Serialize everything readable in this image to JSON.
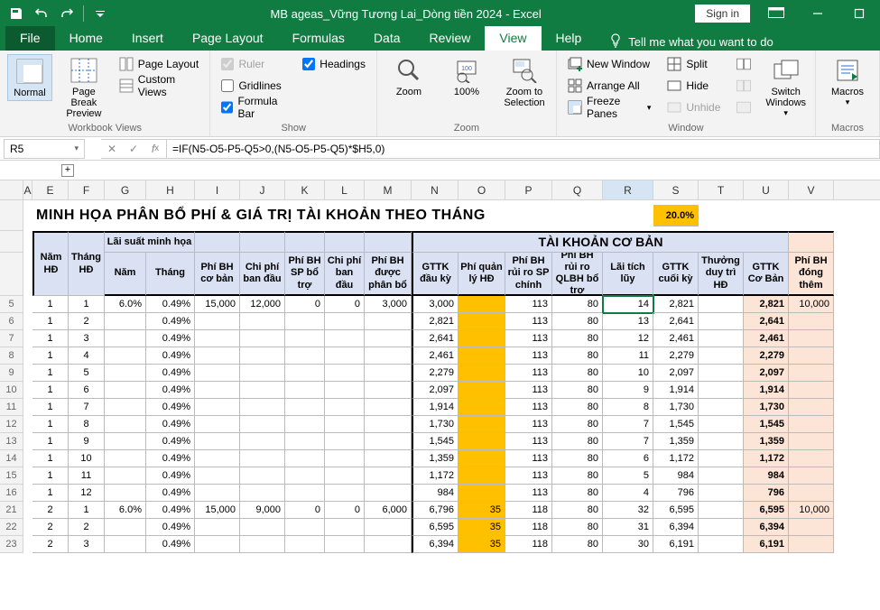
{
  "titlebar": {
    "title": "MB ageas_Vững Tương Lai_Dòng tiền 2024 - Excel",
    "signin": "Sign in"
  },
  "tabs": {
    "file": "File",
    "home": "Home",
    "insert": "Insert",
    "pagelayout": "Page Layout",
    "formulas": "Formulas",
    "data": "Data",
    "review": "Review",
    "view": "View",
    "help": "Help",
    "tellme": "Tell me what you want to do"
  },
  "ribbon": {
    "groups": {
      "views": "Workbook Views",
      "show": "Show",
      "zoom": "Zoom",
      "window": "Window",
      "macros": "Macros"
    },
    "buttons": {
      "normal": "Normal",
      "pagebreak": "Page Break Preview",
      "pagelayout": "Page Layout",
      "custom": "Custom Views",
      "ruler": "Ruler",
      "gridlines": "Gridlines",
      "formulabar": "Formula Bar",
      "headings": "Headings",
      "zoom": "Zoom",
      "z100": "100%",
      "zoomsel": "Zoom to Selection",
      "newwin": "New Window",
      "arrange": "Arrange All",
      "freeze": "Freeze Panes",
      "split": "Split",
      "hide": "Hide",
      "unhide": "Unhide",
      "switch": "Switch Windows",
      "macros": "Macros"
    }
  },
  "formulabar": {
    "cellref": "R5",
    "formula": "=IF(N5-O5-P5-Q5>0,(N5-O5-P5-Q5)*$H5,0)"
  },
  "columns": [
    "A",
    "E",
    "F",
    "G",
    "H",
    "I",
    "J",
    "K",
    "L",
    "M",
    "N",
    "O",
    "P",
    "Q",
    "R",
    "S",
    "T",
    "U",
    "V"
  ],
  "sheet": {
    "main_title": "MINH HỌA PHÂN BỔ PHÍ & GIÁ TRỊ TÀI KHOẢN THEO THÁNG",
    "pct": "20.0%",
    "section2": "TÀI KHOẢN CƠ BẢN",
    "headers": {
      "nam_hd": "Năm HĐ",
      "thang_hd": "Tháng HĐ",
      "ls": "Lãi suất minh họa",
      "nam": "Năm",
      "thang": "Tháng",
      "phi_bh": "Phí BH cơ bản",
      "chi_phi": "Chi phí ban đầu",
      "phi_sp": "Phí BH SP bổ trợ",
      "chi_phi2": "Chi phí ban đầu",
      "phi_duoc": "Phí BH được phân bổ",
      "gttk_dau": "GTTK đầu kỳ",
      "phi_ql": "Phí quản lý HĐ",
      "phi_rr_sp": "Phí BH rủi ro SP chính",
      "phi_rr_ql": "Phí BH rủi ro QLBH bổ trợ",
      "lai_tich": "Lãi tích lũy",
      "gttk_cuoi": "GTTK cuối kỳ",
      "thuong": "Thưởng duy trì HĐ",
      "gttk_co": "GTTK Cơ Bản",
      "phi_dong": "Phí BH đóng thêm"
    }
  },
  "data_rows": [
    {
      "r": 5,
      "e": "1",
      "f": "1",
      "g": "6.0%",
      "h": "0.49%",
      "i": "15,000",
      "j": "12,000",
      "k": "0",
      "l": "0",
      "m": "3,000",
      "n": "3,000",
      "o": "",
      "p": "113",
      "q": "80",
      "r_": "14",
      "s": "2,821",
      "t": "",
      "u": "2,821",
      "v": "10,000"
    },
    {
      "r": 6,
      "e": "1",
      "f": "2",
      "g": "",
      "h": "0.49%",
      "i": "",
      "j": "",
      "k": "",
      "l": "",
      "m": "",
      "n": "2,821",
      "o": "",
      "p": "113",
      "q": "80",
      "r_": "13",
      "s": "2,641",
      "t": "",
      "u": "2,641",
      "v": ""
    },
    {
      "r": 7,
      "e": "1",
      "f": "3",
      "g": "",
      "h": "0.49%",
      "i": "",
      "j": "",
      "k": "",
      "l": "",
      "m": "",
      "n": "2,641",
      "o": "",
      "p": "113",
      "q": "80",
      "r_": "12",
      "s": "2,461",
      "t": "",
      "u": "2,461",
      "v": ""
    },
    {
      "r": 8,
      "e": "1",
      "f": "4",
      "g": "",
      "h": "0.49%",
      "i": "",
      "j": "",
      "k": "",
      "l": "",
      "m": "",
      "n": "2,461",
      "o": "",
      "p": "113",
      "q": "80",
      "r_": "11",
      "s": "2,279",
      "t": "",
      "u": "2,279",
      "v": ""
    },
    {
      "r": 9,
      "e": "1",
      "f": "5",
      "g": "",
      "h": "0.49%",
      "i": "",
      "j": "",
      "k": "",
      "l": "",
      "m": "",
      "n": "2,279",
      "o": "",
      "p": "113",
      "q": "80",
      "r_": "10",
      "s": "2,097",
      "t": "",
      "u": "2,097",
      "v": ""
    },
    {
      "r": 10,
      "e": "1",
      "f": "6",
      "g": "",
      "h": "0.49%",
      "i": "",
      "j": "",
      "k": "",
      "l": "",
      "m": "",
      "n": "2,097",
      "o": "",
      "p": "113",
      "q": "80",
      "r_": "9",
      "s": "1,914",
      "t": "",
      "u": "1,914",
      "v": ""
    },
    {
      "r": 11,
      "e": "1",
      "f": "7",
      "g": "",
      "h": "0.49%",
      "i": "",
      "j": "",
      "k": "",
      "l": "",
      "m": "",
      "n": "1,914",
      "o": "",
      "p": "113",
      "q": "80",
      "r_": "8",
      "s": "1,730",
      "t": "",
      "u": "1,730",
      "v": ""
    },
    {
      "r": 12,
      "e": "1",
      "f": "8",
      "g": "",
      "h": "0.49%",
      "i": "",
      "j": "",
      "k": "",
      "l": "",
      "m": "",
      "n": "1,730",
      "o": "",
      "p": "113",
      "q": "80",
      "r_": "7",
      "s": "1,545",
      "t": "",
      "u": "1,545",
      "v": ""
    },
    {
      "r": 13,
      "e": "1",
      "f": "9",
      "g": "",
      "h": "0.49%",
      "i": "",
      "j": "",
      "k": "",
      "l": "",
      "m": "",
      "n": "1,545",
      "o": "",
      "p": "113",
      "q": "80",
      "r_": "7",
      "s": "1,359",
      "t": "",
      "u": "1,359",
      "v": ""
    },
    {
      "r": 14,
      "e": "1",
      "f": "10",
      "g": "",
      "h": "0.49%",
      "i": "",
      "j": "",
      "k": "",
      "l": "",
      "m": "",
      "n": "1,359",
      "o": "",
      "p": "113",
      "q": "80",
      "r_": "6",
      "s": "1,172",
      "t": "",
      "u": "1,172",
      "v": ""
    },
    {
      "r": 15,
      "e": "1",
      "f": "11",
      "g": "",
      "h": "0.49%",
      "i": "",
      "j": "",
      "k": "",
      "l": "",
      "m": "",
      "n": "1,172",
      "o": "",
      "p": "113",
      "q": "80",
      "r_": "5",
      "s": "984",
      "t": "",
      "u": "984",
      "v": ""
    },
    {
      "r": 16,
      "e": "1",
      "f": "12",
      "g": "",
      "h": "0.49%",
      "i": "",
      "j": "",
      "k": "",
      "l": "",
      "m": "",
      "n": "984",
      "o": "",
      "p": "113",
      "q": "80",
      "r_": "4",
      "s": "796",
      "t": "",
      "u": "796",
      "v": ""
    },
    {
      "r": 21,
      "e": "2",
      "f": "1",
      "g": "6.0%",
      "h": "0.49%",
      "i": "15,000",
      "j": "9,000",
      "k": "0",
      "l": "0",
      "m": "6,000",
      "n": "6,796",
      "o": "35",
      "p": "118",
      "q": "80",
      "r_": "32",
      "s": "6,595",
      "t": "",
      "u": "6,595",
      "v": "10,000"
    },
    {
      "r": 22,
      "e": "2",
      "f": "2",
      "g": "",
      "h": "0.49%",
      "i": "",
      "j": "",
      "k": "",
      "l": "",
      "m": "",
      "n": "6,595",
      "o": "35",
      "p": "118",
      "q": "80",
      "r_": "31",
      "s": "6,394",
      "t": "",
      "u": "6,394",
      "v": ""
    },
    {
      "r": 23,
      "e": "2",
      "f": "3",
      "g": "",
      "h": "0.49%",
      "i": "",
      "j": "",
      "k": "",
      "l": "",
      "m": "",
      "n": "6,394",
      "o": "35",
      "p": "118",
      "q": "80",
      "r_": "30",
      "s": "6,191",
      "t": "",
      "u": "6,191",
      "v": ""
    }
  ],
  "col_widths": {
    "row": 26,
    "A": 10,
    "E": 40,
    "F": 40,
    "G": 46,
    "H": 54,
    "I": 50,
    "J": 50,
    "K": 44,
    "L": 44,
    "M": 52,
    "N": 52,
    "O": 52,
    "P": 52,
    "Q": 56,
    "R": 56,
    "S": 50,
    "T": 50,
    "U": 50,
    "V": 50
  }
}
